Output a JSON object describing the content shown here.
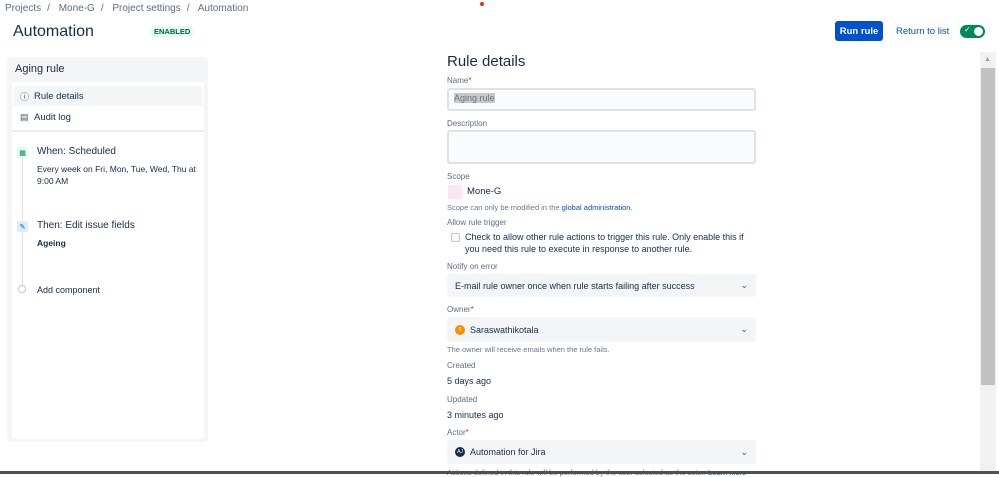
{
  "breadcrumb": [
    "Projects",
    "Mone-G",
    "Project settings",
    "Automation"
  ],
  "header": {
    "title": "Automation",
    "status_badge": "ENABLED",
    "run_rule": "Run rule",
    "return_to_list": "Return to list",
    "toggle_on": true
  },
  "sidebar": {
    "rule_name": "Aging rule",
    "nav": [
      {
        "label": "Rule details",
        "icon": "info-icon",
        "selected": true
      },
      {
        "label": "Audit log",
        "icon": "document-icon",
        "selected": false
      }
    ],
    "trigger": {
      "title": "When: Scheduled",
      "detail": "Every week on Fri, Mon, Tue, Wed, Thu at 9:00 AM"
    },
    "action": {
      "title": "Then: Edit issue fields",
      "detail": "Ageing"
    },
    "add_component": "Add component"
  },
  "form": {
    "heading": "Rule details",
    "name_label": "Name",
    "name_value": "Aging rule",
    "description_label": "Description",
    "description_value": "",
    "scope_label": "Scope",
    "scope_value": "Mone-G",
    "scope_hint": "Scope can only be modified in the ",
    "scope_link": "global administration",
    "scope_hint_end": ".",
    "allow_trigger_label": "Allow rule trigger",
    "allow_trigger_text": "Check to allow other rule actions to trigger this rule. Only enable this if you need this rule to execute in response to another rule.",
    "allow_trigger_checked": false,
    "notify_label": "Notify on error",
    "notify_value": "E-mail rule owner once when rule starts failing after success",
    "owner_label": "Owner",
    "owner_value": "Saraswathikotala",
    "owner_initial": "S",
    "owner_hint": "The owner will receive emails when the rule fails.",
    "created_label": "Created",
    "created_value": "5 days ago",
    "updated_label": "Updated",
    "updated_value": "3 minutes ago",
    "actor_label": "Actor",
    "actor_value": "Automation for Jira",
    "actor_initial": "AJ",
    "actor_hint": "Actions defined in this rule will be performed by the user selected as the actor.",
    "actor_link": "Learn more",
    "required_mark": "*"
  },
  "colors": {
    "primary": "#0052cc",
    "success": "#00875a",
    "badge_bg": "#e3fcef",
    "badge_text": "#006644"
  }
}
